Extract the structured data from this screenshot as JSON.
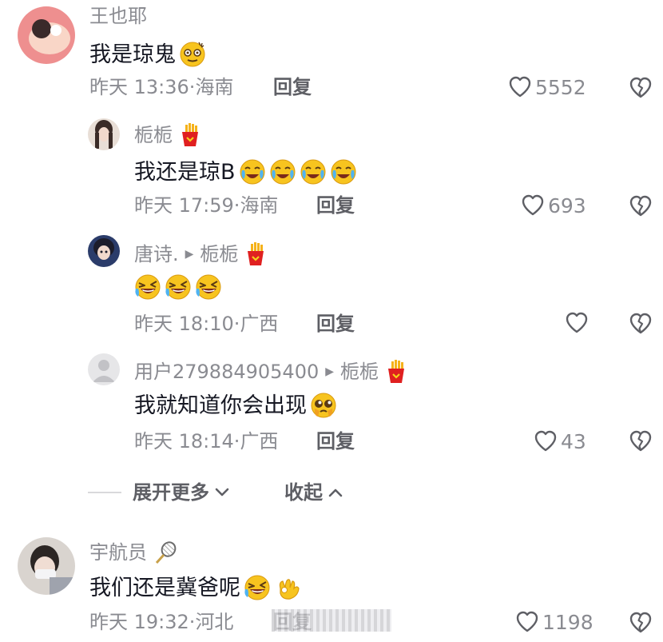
{
  "comments": [
    {
      "username": "王也耶",
      "text": "我是琼鬼",
      "time": "昨天 13:36",
      "location": "海南",
      "reply_label": "回复",
      "likes": "5552"
    },
    {
      "username": "栀栀",
      "text": "我还是琼B",
      "time": "昨天 17:59",
      "location": "海南",
      "reply_label": "回复",
      "likes": "693"
    },
    {
      "username": "唐诗.",
      "reply_to": "栀栀",
      "text": "",
      "time": "昨天 18:10",
      "location": "广西",
      "reply_label": "回复",
      "likes": ""
    },
    {
      "username": "用户279884905400",
      "reply_to": "栀栀",
      "text": "我就知道你会出现",
      "time": "昨天 18:14",
      "location": "广西",
      "reply_label": "回复",
      "likes": "43"
    },
    {
      "username": "宇航员",
      "text": "我们还是冀爸呢",
      "time": "昨天 19:32",
      "location": "河北",
      "reply_label": "回复",
      "likes": "1198"
    }
  ],
  "thread_controls": {
    "expand_label": "展开更多",
    "collapse_label": "收起"
  },
  "separator": "·",
  "icons": {
    "like": "heart-outline-icon",
    "dislike": "broken-heart-icon",
    "fries_badge": "french-fries-icon"
  },
  "colors": {
    "secondary_text": "#8a8b91",
    "primary_text": "#161823",
    "emoji_yellow": "#f7c41f"
  }
}
